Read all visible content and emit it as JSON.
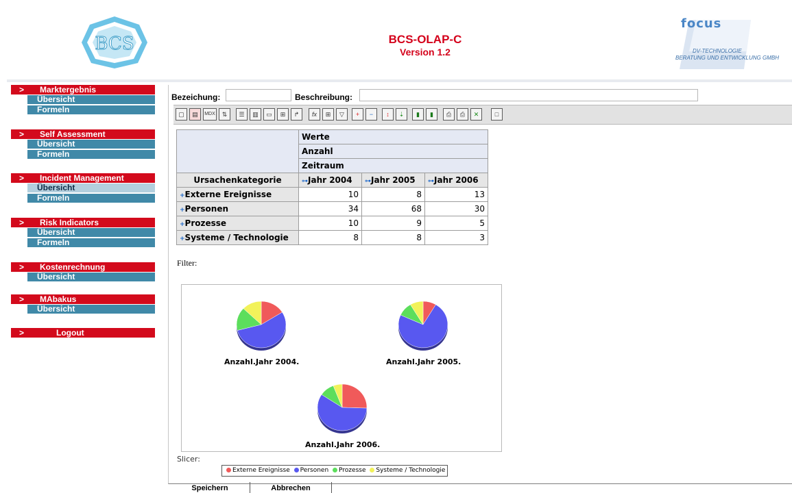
{
  "header": {
    "title": "BCS-OLAP-C",
    "version": "Version 1.2",
    "focus_brand": "focus",
    "focus_line1": "DV-TECHNOLOGIE",
    "focus_line2": "BERATUNG UND ENTWICKLUNG GMBH",
    "bcs_logo_text": "BCS"
  },
  "sidebar": {
    "arrow": ">",
    "groups": [
      {
        "label": "Marktergebnis",
        "items": [
          "Übersicht",
          "Formeln"
        ]
      },
      {
        "label": "Self Assessment",
        "items": [
          "Übersicht",
          "Formeln"
        ]
      },
      {
        "label": "Incident Management",
        "items": [
          "Übersicht",
          "Formeln"
        ]
      },
      {
        "label": "Risk Indicators",
        "items": [
          "Übersicht",
          "Formeln"
        ]
      },
      {
        "label": "Kostenrechnung",
        "items": [
          "Übersicht"
        ]
      },
      {
        "label": "MAbakus",
        "items": [
          "Übersicht"
        ]
      },
      {
        "label": "Logout",
        "items": []
      }
    ]
  },
  "form": {
    "bezeichnung_label": "Bezeichung:",
    "bezeichnung_value": "",
    "beschreibung_label": "Beschreibung:",
    "beschreibung_value": ""
  },
  "toolbar": {
    "mdx_label": "MDX",
    "fx_label": "fx"
  },
  "pivot": {
    "col_dims": [
      "Werte",
      "Anzahl",
      "Zeitraum"
    ],
    "row_dim": "Ursachenkategorie",
    "columns": [
      "Jahr 2004",
      "Jahr 2005",
      "Jahr 2006"
    ],
    "rows": [
      {
        "label": "Externe Ereignisse",
        "values": [
          10,
          8,
          13
        ]
      },
      {
        "label": "Personen",
        "values": [
          34,
          68,
          30
        ]
      },
      {
        "label": "Prozesse",
        "values": [
          10,
          9,
          5
        ]
      },
      {
        "label": "Systeme / Technologie",
        "values": [
          8,
          8,
          3
        ]
      }
    ]
  },
  "filter_label": "Filter:",
  "slicer_label": "Slicer:",
  "chart_data": {
    "type": "pie",
    "charts": [
      {
        "title": "Anzahl.Jahr 2004.",
        "values": [
          10,
          34,
          10,
          8
        ]
      },
      {
        "title": "Anzahl.Jahr 2005.",
        "values": [
          8,
          68,
          9,
          8
        ]
      },
      {
        "title": "Anzahl.Jahr 2006.",
        "values": [
          13,
          30,
          5,
          3
        ]
      }
    ],
    "categories": [
      "Externe Ereignisse",
      "Personen",
      "Prozesse",
      "Systeme / Technologie"
    ],
    "colors": [
      "#f05a5a",
      "#5858f0",
      "#5cde5c",
      "#f2f25a"
    ],
    "legend": "bottom"
  },
  "buttons": {
    "save": "Speichern",
    "cancel": "Abbrechen"
  }
}
